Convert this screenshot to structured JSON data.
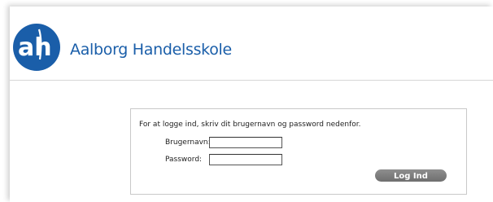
{
  "header": {
    "school_name": "Aalborg Handelsskole",
    "logo_text": "ah",
    "brand_color": "#1a5ea9"
  },
  "login": {
    "intro": "For at logge ind, skriv dit brugernavn og password nedenfor.",
    "username_label": "Brugernavn:",
    "username_value": "",
    "password_label": "Password:",
    "password_value": "",
    "submit_label": "Log Ind"
  }
}
